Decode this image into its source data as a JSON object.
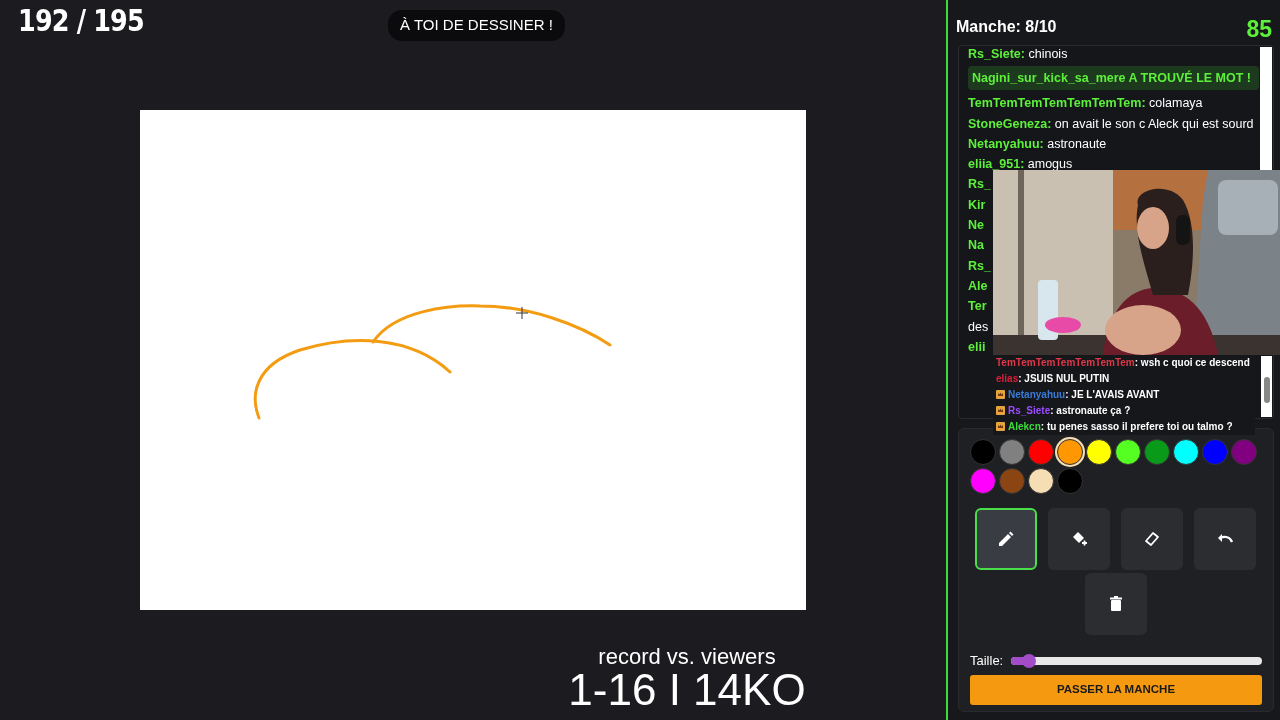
{
  "round_counter": "192 / 195",
  "turn_banner": "À TOI DE DESSINER !",
  "overlay": {
    "line_1": "record vs. viewers",
    "line_2": "1-16 I 14KO"
  },
  "panel": {
    "round": "Manche: 8/10",
    "timer": "85"
  },
  "chat": [
    {
      "kind": "message",
      "user": "Rs_Siete:",
      "text": "chinois"
    },
    {
      "kind": "found",
      "text": "Nagini_sur_kick_sa_mere A TROUVÉ LE MOT !"
    },
    {
      "kind": "message",
      "user": "TemTemTemTemTemTemTem:",
      "text": "colamaya"
    },
    {
      "kind": "message",
      "user": "StoneGeneza:",
      "text": "on avait le son c Aleck qui est sourd"
    },
    {
      "kind": "message",
      "user": "Netanyahuu:",
      "text": "astronaute"
    },
    {
      "kind": "message",
      "user": "eliia_951:",
      "text": "amogus"
    },
    {
      "kind": "message",
      "user": "Rs_"
    },
    {
      "kind": "message",
      "user": "Kir"
    },
    {
      "kind": "message",
      "user": "Ne"
    },
    {
      "kind": "message",
      "user": "Na"
    },
    {
      "kind": "message",
      "user": "Rs_"
    },
    {
      "kind": "message",
      "user": "Ale"
    },
    {
      "kind": "message",
      "user": "Ter"
    },
    {
      "kind": "continuation",
      "text": "des"
    },
    {
      "kind": "message",
      "user": "elii"
    }
  ],
  "stream_chat": [
    {
      "user": "TemTemTemTemTemTemTem",
      "color": "#e0384a",
      "badge": false,
      "text": ": wsh c quoi ce descend"
    },
    {
      "user": "elias",
      "color": "#d8203a",
      "badge": false,
      "text": ": JSUIS NUL PUTIN"
    },
    {
      "user": "Netanyahuu",
      "color": "#3a7bd5",
      "badge": true,
      "text": ": JE L'AVAIS AVANT"
    },
    {
      "user": "Rs_Siete",
      "color": "#9b4dff",
      "badge": true,
      "text": ": astronaute ça ?"
    },
    {
      "user": "Alekcn",
      "color": "#3ddc3d",
      "badge": true,
      "text": ": tu penes sasso il prefere toi ou talmo ?"
    }
  ],
  "palette": [
    {
      "color": "#000000",
      "selected": false
    },
    {
      "color": "#808080",
      "selected": false
    },
    {
      "color": "#ff0000",
      "selected": false
    },
    {
      "color": "#ff9800",
      "selected": true
    },
    {
      "color": "#ffff00",
      "selected": false
    },
    {
      "color": "#55ff22",
      "selected": false
    },
    {
      "color": "#0a9a1a",
      "selected": false
    },
    {
      "color": "#00ffff",
      "selected": false
    },
    {
      "color": "#0000ff",
      "selected": false
    },
    {
      "color": "#800080",
      "selected": false
    },
    {
      "color": "#ff00ff",
      "selected": false
    },
    {
      "color": "#8b4513",
      "selected": false
    },
    {
      "color": "#f5deb3",
      "selected": false
    },
    {
      "color": "#000000",
      "selected": false
    }
  ],
  "tools": [
    {
      "kind": "pencil",
      "selected": true
    },
    {
      "kind": "fill",
      "selected": false
    },
    {
      "kind": "eraser",
      "selected": false
    },
    {
      "kind": "undo",
      "selected": false
    },
    {
      "kind": "trash",
      "selected": false
    }
  ],
  "size": {
    "label": "Taille:",
    "level": 0.07
  },
  "skip_button": "PASSER LA MANCHE"
}
